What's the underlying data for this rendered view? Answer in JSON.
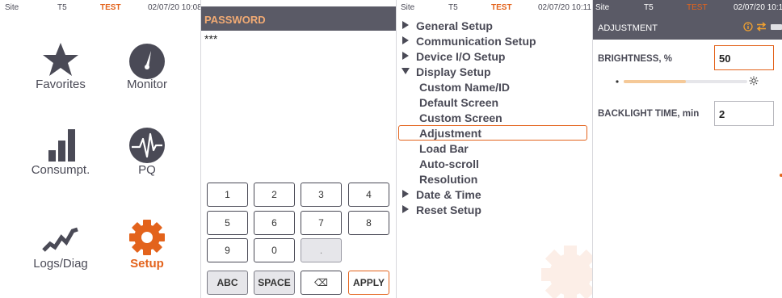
{
  "status": {
    "site": "Site",
    "device": "T5",
    "mode": "TEST",
    "datetime": "02/07/20 10:08",
    "datetime_p3": "02/07/20 10:11",
    "datetime_p4": "02/07/20 10:1"
  },
  "home": {
    "tiles": [
      {
        "label": "Favorites",
        "icon": "star-icon"
      },
      {
        "label": "Monitor",
        "icon": "gauge-icon"
      },
      {
        "label": "Consumpt.",
        "icon": "bar-chart-icon"
      },
      {
        "label": "PQ",
        "icon": "pq-waveform-icon"
      },
      {
        "label": "Logs/Diag",
        "icon": "trend-line-icon"
      },
      {
        "label": "Setup",
        "icon": "gear-icon"
      }
    ]
  },
  "password": {
    "title": "PASSWORD",
    "value": "***",
    "keys": {
      "k1": "1",
      "k2": "2",
      "k3": "3",
      "k4": "4",
      "k5": "5",
      "k6": "6",
      "k7": "7",
      "k8": "8",
      "k9": "9",
      "k0": "0",
      "dot": ".",
      "abc": "ABC",
      "space": "SPACE",
      "backspace": "⌫",
      "apply": "APPLY"
    }
  },
  "setup_menu": {
    "items": [
      {
        "label": "General Setup",
        "kind": "collapsed"
      },
      {
        "label": "Communication Setup",
        "kind": "collapsed"
      },
      {
        "label": "Device I/O Setup",
        "kind": "collapsed"
      },
      {
        "label": "Display Setup",
        "kind": "expanded"
      },
      {
        "label": "Custom Name/ID",
        "kind": "sub"
      },
      {
        "label": "Default Screen",
        "kind": "sub"
      },
      {
        "label": "Custom Screen",
        "kind": "sub"
      },
      {
        "label": "Adjustment",
        "kind": "sub-selected"
      },
      {
        "label": "Load Bar",
        "kind": "sub"
      },
      {
        "label": "Auto-scroll",
        "kind": "sub"
      },
      {
        "label": "Resolution",
        "kind": "sub"
      },
      {
        "label": "Date & Time",
        "kind": "collapsed"
      },
      {
        "label": "Reset Setup",
        "kind": "collapsed"
      }
    ]
  },
  "adjustment": {
    "title": "ADJUSTMENT",
    "brightness_label": "BRIGHTNESS, %",
    "brightness_value": "50",
    "brightness_fraction": 0.5,
    "backlight_label": "BACKLIGHT TIME, min",
    "backlight_value": "2"
  },
  "colors": {
    "accent": "#e3631c",
    "header_bg": "#5a5a66",
    "icon": "#4a4a56",
    "password_title": "#f2ab74"
  }
}
